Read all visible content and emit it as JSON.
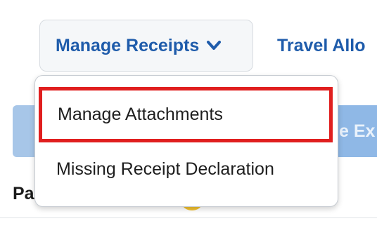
{
  "toolbar": {
    "manage_receipts_label": "Manage Receipts",
    "travel_label": "Travel Allo"
  },
  "background": {
    "hidden_button_fragment": "e Ex",
    "section_fragment": "Pa"
  },
  "dropdown": {
    "items": [
      {
        "label": "Manage Attachments",
        "highlighted": true
      },
      {
        "label": "Missing Receipt Declaration"
      }
    ]
  },
  "colors": {
    "link_blue": "#1f5cab",
    "highlight_red": "#e01f1f",
    "button_blue": "#8fb8e6",
    "status_yellow": "#f2c232"
  },
  "icons": {
    "manage_chevron": "chevron-down-icon",
    "status_indicator": "status-dot-icon"
  }
}
